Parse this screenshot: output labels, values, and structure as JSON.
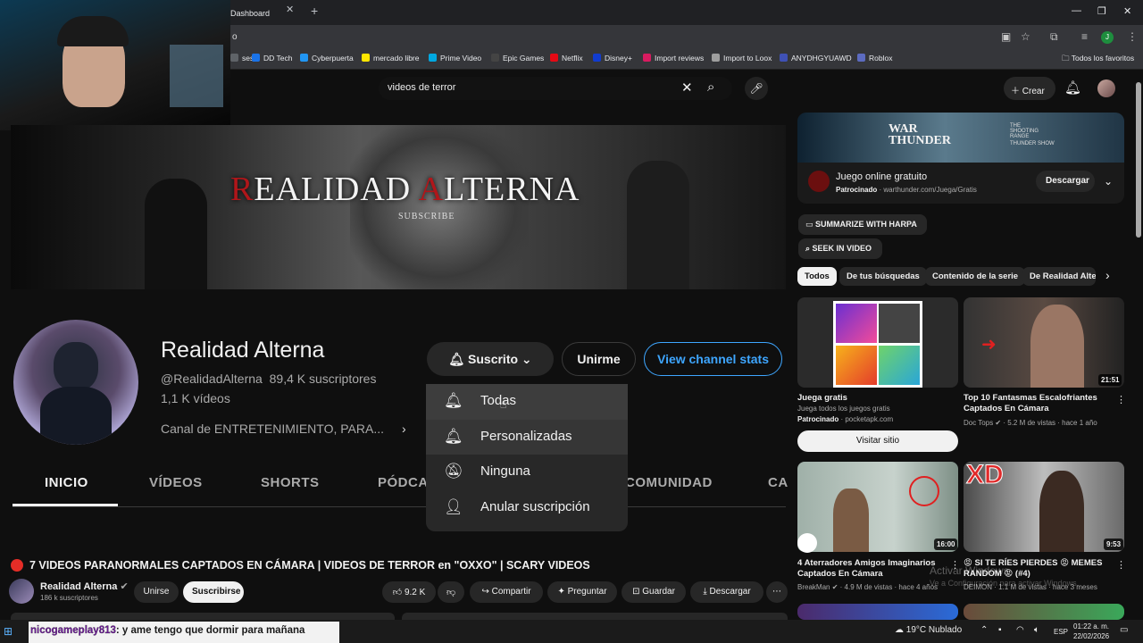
{
  "browser": {
    "tab_title": "Dashboard",
    "bookmarks": [
      {
        "label": "ses",
        "color": "#5f6368"
      },
      {
        "label": "DD Tech",
        "color": "#1a73e8"
      },
      {
        "label": "Cyberpuerta",
        "color": "#2196f3"
      },
      {
        "label": "mercado libre",
        "color": "#ffe600"
      },
      {
        "label": "Prime Video",
        "color": "#00a8e1"
      },
      {
        "label": "Epic Games",
        "color": "#444444"
      },
      {
        "label": "Netflix",
        "color": "#e50914"
      },
      {
        "label": "Disney+",
        "color": "#113ccf"
      },
      {
        "label": "Import reviews",
        "color": "#d81b60"
      },
      {
        "label": "Import to Loox",
        "color": "#9e9e9e"
      },
      {
        "label": "ANYDHGYUAWD",
        "color": "#3f51b5"
      },
      {
        "label": "Roblox",
        "color": "#5c6bc0"
      }
    ],
    "all_favorites": "Todos los favoritos",
    "address_fragment": "o"
  },
  "youtube": {
    "search_value": "videos de terror",
    "create_label": "Crear"
  },
  "channel": {
    "banner_title_r": "R",
    "banner_title_main": "EALIDAD ",
    "banner_title_a": "A",
    "banner_title_rest": "LTERNA",
    "banner_subscribe": "SUBSCRIBE",
    "name": "Realidad Alterna",
    "handle": "@RealidadAlterna",
    "subscribers": "89,4 K suscriptores",
    "videos": "1,1 K vídeos",
    "description": "Canal de ENTRETENIMIENTO, PARA...",
    "subscribed_label": "Suscrito",
    "join_label": "Unirme",
    "stats_label": "View channel stats",
    "tabs": [
      "INICIO",
      "VÍDEOS",
      "SHORTS",
      "PÓDCA",
      "COMUNIDAD",
      "CA"
    ]
  },
  "notif_menu": {
    "items": [
      "Todas",
      "Personalizadas",
      "Ninguna",
      "Anular suscripción"
    ]
  },
  "featured_video": {
    "title": "7 VIDEOS PARANORMALES CAPTADOS EN CÁMARA | VIDEOS DE TERROR en \"OXXO\" | SCARY VIDEOS",
    "owner": "Realidad Alterna",
    "owner_subs": "186 k suscriptores",
    "join": "Unirse",
    "subscribe": "Suscribirse",
    "likes": "9.2 K",
    "share": "Compartir",
    "ask": "Preguntar",
    "save": "Guardar",
    "download": "Descargar"
  },
  "sidebar": {
    "ad": {
      "title": "Juego online gratuito",
      "sponsored": "Patrocinado",
      "url": "warthunder.com/Juega/Gratis",
      "button": "Descargar",
      "brand": "WAR THUNDER",
      "banner_text": "THE SHOOTING RANGE",
      "banner_text2": "THUNDER SHOW"
    },
    "harpa": "SUMMARIZE WITH HARPA",
    "seek": "SEEK IN VIDEO",
    "chips": [
      "Todos",
      "De tus búsquedas",
      "Contenido de la serie",
      "De Realidad Alte"
    ],
    "videos": [
      {
        "title": "Juega gratis",
        "line2": "Juega todos los juegos gratis",
        "sponsored": "Patrocinado",
        "source": "pocketapk.com",
        "button": "Visitar sitio",
        "duration": ""
      },
      {
        "title": "Top 10 Fantasmas Escalofriantes Captados En Cámara",
        "channel": "Doc Tops",
        "stats": "5.2 M de vistas · hace 1 año",
        "duration": "21:51"
      },
      {
        "title": "4 Aterradores Amigos Imaginarios Captados En Cámara",
        "channel": "BreakMan",
        "stats": "4.9 M de vistas · hace 4 años",
        "duration": "16:00"
      },
      {
        "title": "😡 SI TE RÍES PIERDES 😡 MEMES RANDOM 😡 (#4)",
        "channel": "DEIMON",
        "stats": "1.1 M de vistas · hace 3 meses",
        "duration": "9:53",
        "thumb_text": "XD"
      }
    ]
  },
  "overlay": {
    "chat_user": "nicogameplay813",
    "chat_msg": ": y ame tengo que dormir para mañana",
    "activate_1": "Activar Windows",
    "activate_2": "Ve a Configuración para activar Windows."
  },
  "taskbar": {
    "weather": "19°C  Nublado",
    "lang": "ESP",
    "time": "01:22 a. m.",
    "date": "22/02/2026"
  }
}
